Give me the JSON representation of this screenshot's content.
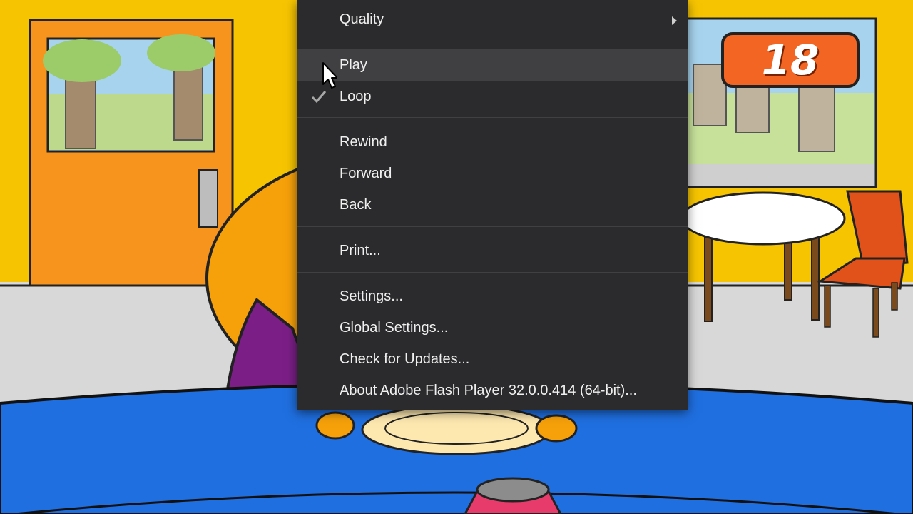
{
  "game": {
    "score": "18"
  },
  "context_menu": {
    "items": [
      {
        "label": "Quality",
        "has_submenu": true
      },
      {
        "label": "Play",
        "highlighted": true
      },
      {
        "label": "Loop",
        "checked": true
      },
      {
        "label": "Rewind"
      },
      {
        "label": "Forward"
      },
      {
        "label": "Back"
      },
      {
        "label": "Print..."
      },
      {
        "label": "Settings..."
      },
      {
        "label": "Global Settings..."
      },
      {
        "label": "Check for Updates..."
      },
      {
        "label": "About Adobe Flash Player 32.0.0.414 (64-bit)..."
      }
    ]
  },
  "colors": {
    "menu_bg": "#2b2b2d",
    "menu_hover": "#404042",
    "menu_text": "#f0f0f0",
    "wall": "#f6c400",
    "floor": "#d6d6d6",
    "carpet": "#1f6fe0",
    "score_badge": "#f26522"
  }
}
